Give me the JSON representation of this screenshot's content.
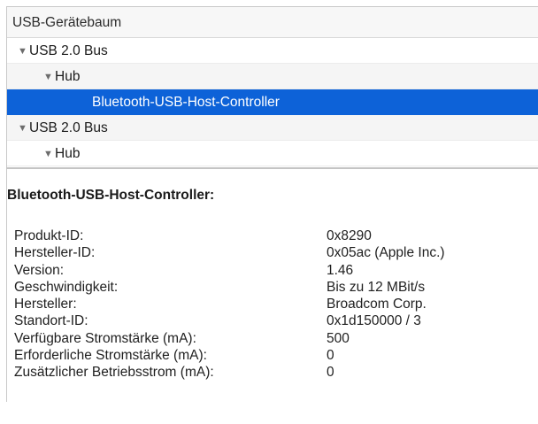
{
  "tree": {
    "header": "USB-Gerätebaum",
    "rows": [
      {
        "label": "USB 2.0 Bus",
        "expanded": true
      },
      {
        "label": "Hub",
        "expanded": true
      },
      {
        "label": "Bluetooth-USB-Host-Controller",
        "selected": true
      },
      {
        "label": "USB 2.0 Bus",
        "expanded": true
      },
      {
        "label": "Hub",
        "expanded": true
      }
    ],
    "expanded_glyph": "▼"
  },
  "detail": {
    "title": "Bluetooth-USB-Host-Controller:",
    "properties": [
      {
        "key": "Produkt-ID:",
        "value": "0x8290"
      },
      {
        "key": "Hersteller-ID:",
        "value": "0x05ac (Apple Inc.)"
      },
      {
        "key": "Version:",
        "value": "1.46"
      },
      {
        "key": "Geschwindigkeit:",
        "value": "Bis zu 12 MBit/s"
      },
      {
        "key": "Hersteller:",
        "value": "Broadcom Corp."
      },
      {
        "key": "Standort-ID:",
        "value": "0x1d150000 / 3"
      },
      {
        "key": "Verfügbare Stromstärke (mA):",
        "value": "500"
      },
      {
        "key": "Erforderliche Stromstärke (mA):",
        "value": "0"
      },
      {
        "key": "Zusätzlicher Betriebsstrom (mA):",
        "value": "0"
      }
    ]
  },
  "colors": {
    "selection": "#0d62d8",
    "row_alt": "#f5f5f5"
  }
}
